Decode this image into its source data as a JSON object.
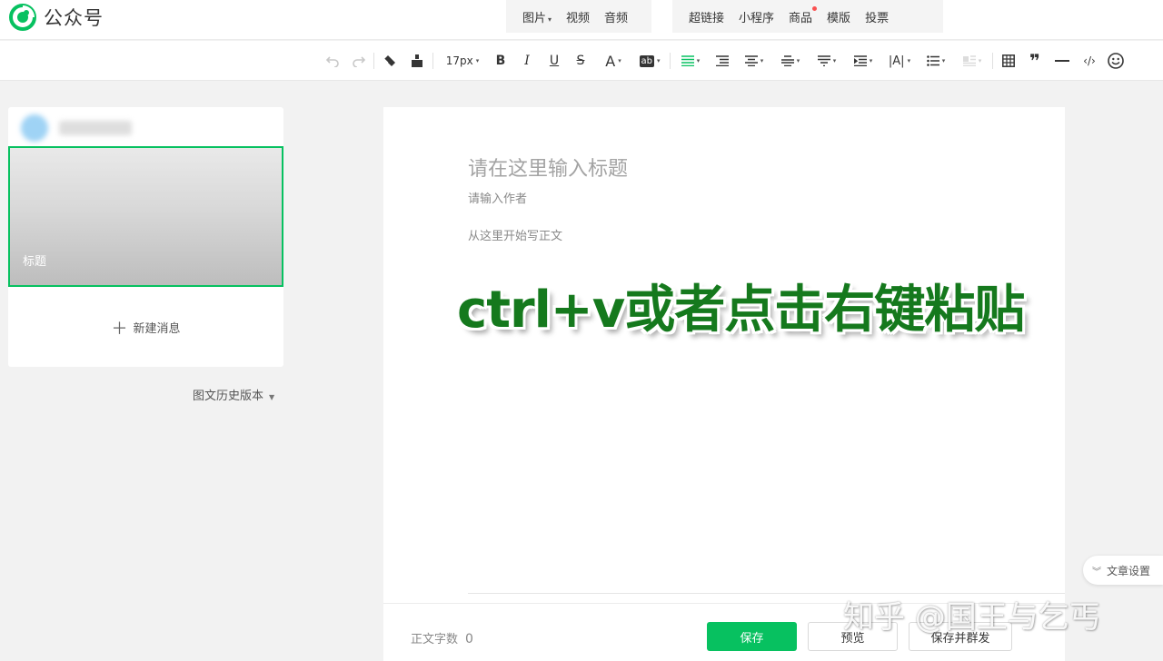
{
  "app": {
    "logo_text": "公众号",
    "brand_color": "#07c160"
  },
  "insert_menu": {
    "group1": [
      {
        "label": "图片",
        "dropdown": true
      },
      {
        "label": "视频"
      },
      {
        "label": "音频"
      }
    ],
    "group2": [
      {
        "label": "超链接"
      },
      {
        "label": "小程序"
      },
      {
        "label": "商品",
        "badge_dot": true
      },
      {
        "label": "模版"
      },
      {
        "label": "投票"
      }
    ]
  },
  "toolbar": {
    "font_size": "17px",
    "bold": "B",
    "italic": "I",
    "underline": "U",
    "strike": "S",
    "font_color": "A",
    "highlight": "ab",
    "icons": [
      "undo-icon",
      "redo-icon",
      "format-painter-icon",
      "clear-format-icon",
      "align-icon",
      "indent-left-icon",
      "align-center-icon",
      "line-height-icon",
      "paragraph-spacing-icon",
      "indent-icon",
      "letter-spacing-icon",
      "list-icon",
      "table-icon",
      "quote-icon",
      "divider-icon",
      "code-icon",
      "emoji-icon"
    ]
  },
  "left_panel": {
    "cover_title": "标题",
    "new_message": "新建消息",
    "history": "图文历史版本"
  },
  "editor": {
    "title_placeholder": "请在这里输入标题",
    "author_placeholder": "请输入作者",
    "body_placeholder": "从这里开始写正文"
  },
  "overlay_text": "ctrl+v或者点击右键粘贴",
  "bottom": {
    "word_count_label": "正文字数",
    "word_count": "0",
    "save": "保存",
    "preview": "预览",
    "save_publish": "保存并群发"
  },
  "article_settings": "文章设置",
  "watermark": "知乎 @国王与乞丐"
}
